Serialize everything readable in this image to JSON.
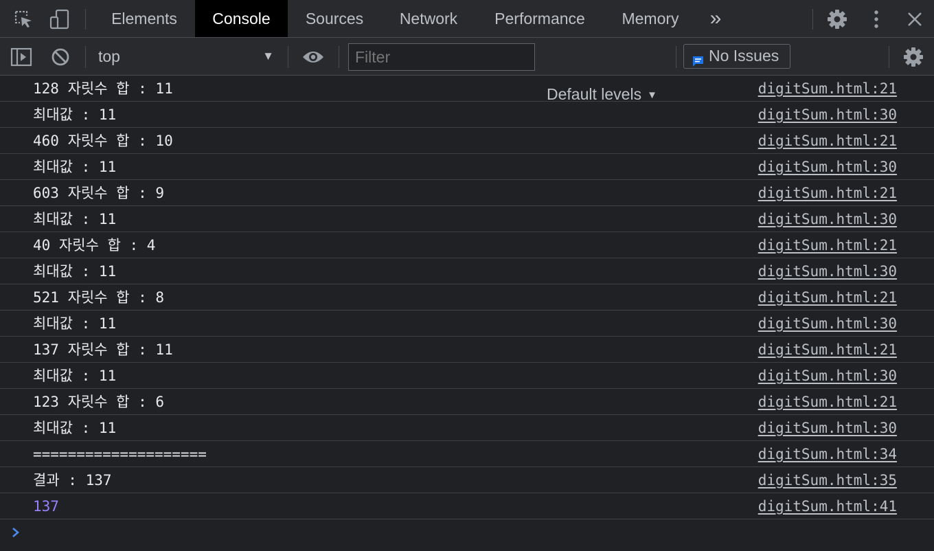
{
  "tabbar": {
    "tabs": [
      {
        "label": "Elements",
        "active": false
      },
      {
        "label": "Console",
        "active": true
      },
      {
        "label": "Sources",
        "active": false
      },
      {
        "label": "Network",
        "active": false
      },
      {
        "label": "Performance",
        "active": false
      },
      {
        "label": "Memory",
        "active": false
      }
    ],
    "more_label": "»"
  },
  "toolbar": {
    "context": "top",
    "filter_placeholder": "Filter",
    "levels_label": "Default levels",
    "issues_label": "No Issues"
  },
  "console": {
    "rows": [
      {
        "message": "128 자릿수 합 : 11",
        "source": "digitSum.html:21",
        "type": "log"
      },
      {
        "message": "최대값 : 11",
        "source": "digitSum.html:30",
        "type": "log"
      },
      {
        "message": "460 자릿수 합 : 10",
        "source": "digitSum.html:21",
        "type": "log"
      },
      {
        "message": "최대값 : 11",
        "source": "digitSum.html:30",
        "type": "log"
      },
      {
        "message": "603 자릿수 합 : 9",
        "source": "digitSum.html:21",
        "type": "log"
      },
      {
        "message": "최대값 : 11",
        "source": "digitSum.html:30",
        "type": "log"
      },
      {
        "message": "40 자릿수 합 : 4",
        "source": "digitSum.html:21",
        "type": "log"
      },
      {
        "message": "최대값 : 11",
        "source": "digitSum.html:30",
        "type": "log"
      },
      {
        "message": "521 자릿수 합 : 8",
        "source": "digitSum.html:21",
        "type": "log"
      },
      {
        "message": "최대값 : 11",
        "source": "digitSum.html:30",
        "type": "log"
      },
      {
        "message": "137 자릿수 합 : 11",
        "source": "digitSum.html:21",
        "type": "log"
      },
      {
        "message": "최대값 : 11",
        "source": "digitSum.html:30",
        "type": "log"
      },
      {
        "message": "123 자릿수 합 : 6",
        "source": "digitSum.html:21",
        "type": "log"
      },
      {
        "message": "최대값 : 11",
        "source": "digitSum.html:30",
        "type": "log"
      },
      {
        "message": "====================",
        "source": "digitSum.html:34",
        "type": "log"
      },
      {
        "message": "결과 : 137",
        "source": "digitSum.html:35",
        "type": "log"
      },
      {
        "message": "137",
        "source": "digitSum.html:41",
        "type": "number"
      }
    ]
  },
  "colors": {
    "background": "#202124",
    "toolbar": "#292a2d",
    "number": "#9980ff",
    "accent": "#1a73e8",
    "prompt": "#4d8af0"
  }
}
